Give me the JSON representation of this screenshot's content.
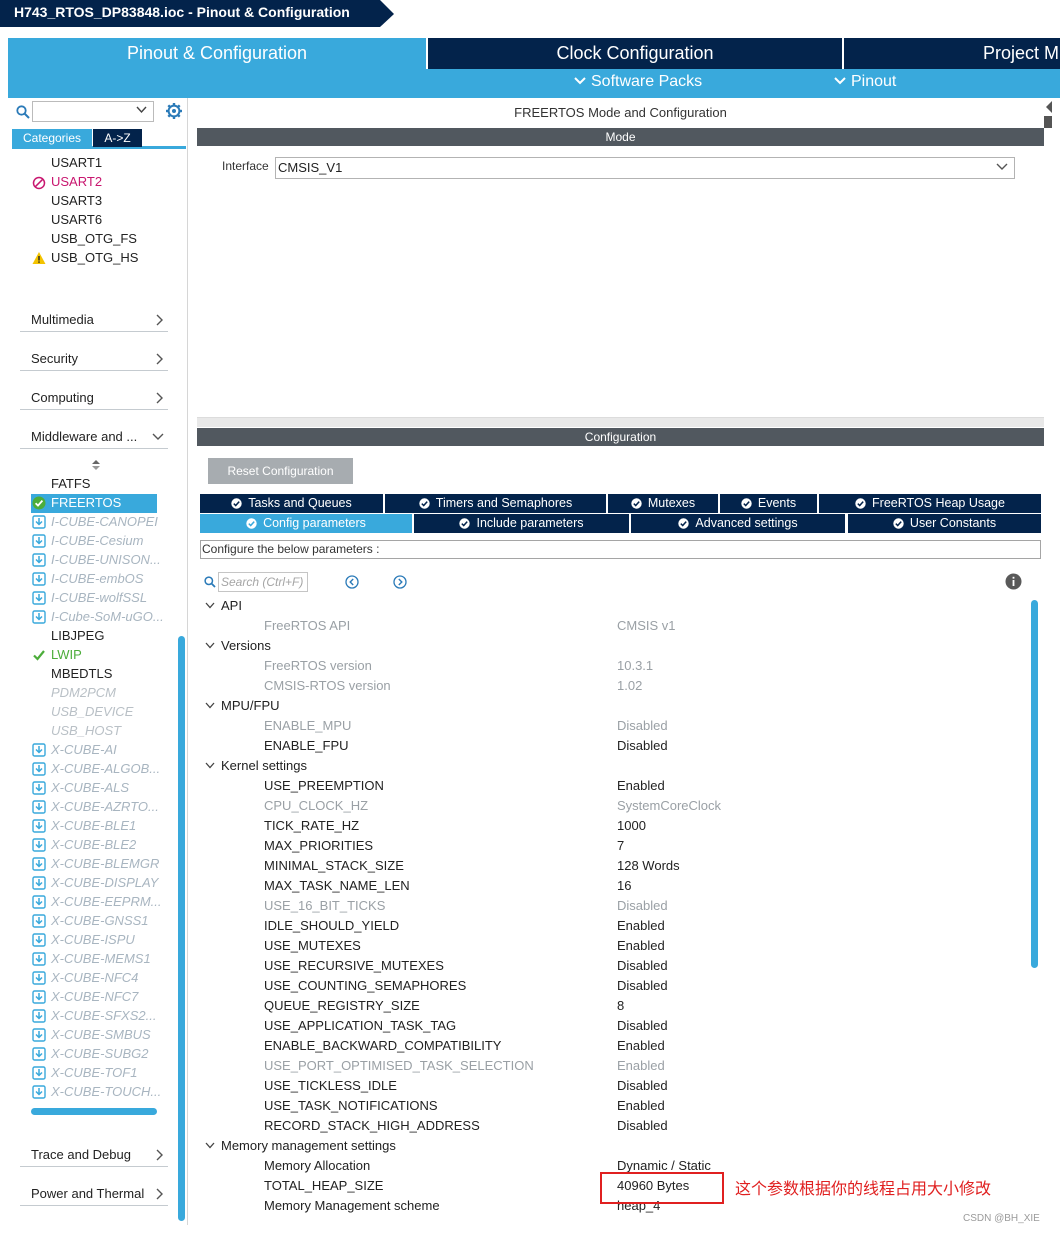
{
  "window": {
    "title": "H743_RTOS_DP83848.ioc - Pinout & Configuration"
  },
  "main_tabs": [
    {
      "label": "Pinout & Configuration"
    },
    {
      "label": "Clock Configuration"
    },
    {
      "label": "Project M"
    }
  ],
  "sub_tabs": [
    {
      "label": "Software Packs"
    },
    {
      "label": "Pinout"
    }
  ],
  "left_panel": {
    "search_value": "",
    "tabs": {
      "categories": "Categories",
      "az": "A->Z"
    },
    "connectivity_items": [
      {
        "label": "USART1",
        "state": "normal"
      },
      {
        "label": "USART2",
        "state": "error"
      },
      {
        "label": "USART3",
        "state": "normal"
      },
      {
        "label": "USART6",
        "state": "normal"
      },
      {
        "label": "USB_OTG_FS",
        "state": "normal"
      },
      {
        "label": "USB_OTG_HS",
        "state": "warning"
      }
    ],
    "sections": {
      "multimedia": "Multimedia",
      "security": "Security",
      "computing": "Computing",
      "middleware": "Middleware and ...",
      "trace": "Trace and Debug",
      "power": "Power and Thermal"
    },
    "middleware_items": [
      {
        "label": "FATFS",
        "state": "normal"
      },
      {
        "label": "FREERTOS",
        "state": "selected-ok"
      },
      {
        "label": "I-CUBE-CANOPEI",
        "state": "pack"
      },
      {
        "label": "I-CUBE-Cesium",
        "state": "pack"
      },
      {
        "label": "I-CUBE-UNISON...",
        "state": "pack"
      },
      {
        "label": "I-CUBE-embOS",
        "state": "pack"
      },
      {
        "label": "I-CUBE-wolfSSL",
        "state": "pack"
      },
      {
        "label": "I-Cube-SoM-uGO...",
        "state": "pack"
      },
      {
        "label": "LIBJPEG",
        "state": "normal"
      },
      {
        "label": "LWIP",
        "state": "ok"
      },
      {
        "label": "MBEDTLS",
        "state": "normal"
      },
      {
        "label": "PDM2PCM",
        "state": "disabled"
      },
      {
        "label": "USB_DEVICE",
        "state": "disabled"
      },
      {
        "label": "USB_HOST",
        "state": "disabled"
      },
      {
        "label": "X-CUBE-AI",
        "state": "pack"
      },
      {
        "label": "X-CUBE-ALGOB...",
        "state": "pack"
      },
      {
        "label": "X-CUBE-ALS",
        "state": "pack"
      },
      {
        "label": "X-CUBE-AZRTO...",
        "state": "pack"
      },
      {
        "label": "X-CUBE-BLE1",
        "state": "pack"
      },
      {
        "label": "X-CUBE-BLE2",
        "state": "pack"
      },
      {
        "label": "X-CUBE-BLEMGR",
        "state": "pack"
      },
      {
        "label": "X-CUBE-DISPLAY",
        "state": "pack"
      },
      {
        "label": "X-CUBE-EEPRM...",
        "state": "pack"
      },
      {
        "label": "X-CUBE-GNSS1",
        "state": "pack"
      },
      {
        "label": "X-CUBE-ISPU",
        "state": "pack"
      },
      {
        "label": "X-CUBE-MEMS1",
        "state": "pack"
      },
      {
        "label": "X-CUBE-NFC4",
        "state": "pack"
      },
      {
        "label": "X-CUBE-NFC7",
        "state": "pack"
      },
      {
        "label": "X-CUBE-SFXS2...",
        "state": "pack"
      },
      {
        "label": "X-CUBE-SMBUS",
        "state": "pack"
      },
      {
        "label": "X-CUBE-SUBG2",
        "state": "pack"
      },
      {
        "label": "X-CUBE-TOF1",
        "state": "pack"
      },
      {
        "label": "X-CUBE-TOUCH...",
        "state": "pack"
      }
    ]
  },
  "main": {
    "header": "FREERTOS Mode and Configuration",
    "mode_bar": "Mode",
    "interface_label": "Interface",
    "interface_value": "CMSIS_V1",
    "config_bar": "Configuration",
    "reset_button": "Reset Configuration",
    "tabs_row1": [
      {
        "label": "Tasks and Queues"
      },
      {
        "label": "Timers and Semaphores"
      },
      {
        "label": "Mutexes"
      },
      {
        "label": "Events"
      },
      {
        "label": "FreeRTOS Heap Usage"
      }
    ],
    "tabs_row2": [
      {
        "label": "Config parameters"
      },
      {
        "label": "Include parameters"
      },
      {
        "label": "Advanced settings"
      },
      {
        "label": "User Constants"
      }
    ],
    "configure_text": "Configure the below parameters :",
    "search_placeholder": "Search (Ctrl+F)",
    "groups": [
      {
        "label": "API",
        "params": [
          {
            "name": "FreeRTOS API",
            "value": "CMSIS v1",
            "dim": true
          }
        ]
      },
      {
        "label": "Versions",
        "params": [
          {
            "name": "FreeRTOS version",
            "value": "10.3.1",
            "dim": true
          },
          {
            "name": "CMSIS-RTOS version",
            "value": "1.02",
            "dim": true
          }
        ]
      },
      {
        "label": "MPU/FPU",
        "params": [
          {
            "name": "ENABLE_MPU",
            "value": "Disabled",
            "dim": true
          },
          {
            "name": "ENABLE_FPU",
            "value": "Disabled",
            "dim": false
          }
        ]
      },
      {
        "label": "Kernel settings",
        "params": [
          {
            "name": "USE_PREEMPTION",
            "value": "Enabled",
            "dim": false
          },
          {
            "name": "CPU_CLOCK_HZ",
            "value": "SystemCoreClock",
            "dim": true
          },
          {
            "name": "TICK_RATE_HZ",
            "value": "1000",
            "dim": false
          },
          {
            "name": "MAX_PRIORITIES",
            "value": "7",
            "dim": false
          },
          {
            "name": "MINIMAL_STACK_SIZE",
            "value": "128 Words",
            "dim": false
          },
          {
            "name": "MAX_TASK_NAME_LEN",
            "value": "16",
            "dim": false
          },
          {
            "name": "USE_16_BIT_TICKS",
            "value": "Disabled",
            "dim": true
          },
          {
            "name": "IDLE_SHOULD_YIELD",
            "value": "Enabled",
            "dim": false
          },
          {
            "name": "USE_MUTEXES",
            "value": "Enabled",
            "dim": false
          },
          {
            "name": "USE_RECURSIVE_MUTEXES",
            "value": "Disabled",
            "dim": false
          },
          {
            "name": "USE_COUNTING_SEMAPHORES",
            "value": "Disabled",
            "dim": false
          },
          {
            "name": "QUEUE_REGISTRY_SIZE",
            "value": "8",
            "dim": false
          },
          {
            "name": "USE_APPLICATION_TASK_TAG",
            "value": "Disabled",
            "dim": false
          },
          {
            "name": "ENABLE_BACKWARD_COMPATIBILITY",
            "value": "Enabled",
            "dim": false
          },
          {
            "name": "USE_PORT_OPTIMISED_TASK_SELECTION",
            "value": "Enabled",
            "dim": true
          },
          {
            "name": "USE_TICKLESS_IDLE",
            "value": "Disabled",
            "dim": false
          },
          {
            "name": "USE_TASK_NOTIFICATIONS",
            "value": "Enabled",
            "dim": false
          },
          {
            "name": "RECORD_STACK_HIGH_ADDRESS",
            "value": "Disabled",
            "dim": false
          }
        ]
      },
      {
        "label": "Memory management settings",
        "params": [
          {
            "name": "Memory Allocation",
            "value": "Dynamic / Static",
            "dim": false
          },
          {
            "name": "TOTAL_HEAP_SIZE",
            "value": "40960 Bytes",
            "dim": false
          },
          {
            "name": "Memory Management scheme",
            "value": "heap_4",
            "dim": false
          }
        ]
      }
    ]
  },
  "annotation": {
    "note": "这个参数根据你的线程占用大小修改",
    "color": "#e02020"
  },
  "watermark": "CSDN @BH_XIE",
  "colors": {
    "navy": "#03234b",
    "accent": "#39a9dc",
    "error": "#c8166f",
    "ok": "#4cad3a"
  }
}
